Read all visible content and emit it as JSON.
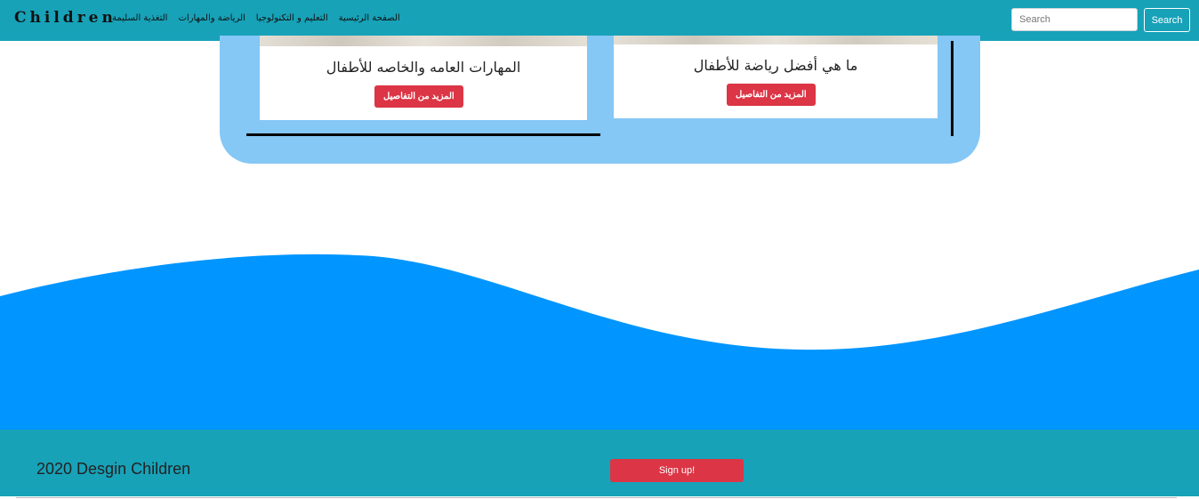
{
  "navbar": {
    "brand": "Children",
    "links": [
      "الصفحة الرئيسية",
      "التعليم و التكنولوجيا",
      "الرياضة والمهارات",
      "التغذية السليمة"
    ],
    "search": {
      "placeholder": "Search",
      "button_label": "Search"
    }
  },
  "cards": [
    {
      "title": "المهارات العامه والخاصه للأطفال",
      "button_label": "المزيد من التفاصيل"
    },
    {
      "title": "ما هي أفضل رياضة للأطفال",
      "button_label": "المزيد من التفاصيل"
    }
  ],
  "footer": {
    "text": "2020 Desgin Children",
    "signup_label": "Sign up!"
  },
  "colors": {
    "navbar": "#17a2b8",
    "panel": "#85c7f5",
    "wave": "#0095ff",
    "button": "#dc3545"
  }
}
